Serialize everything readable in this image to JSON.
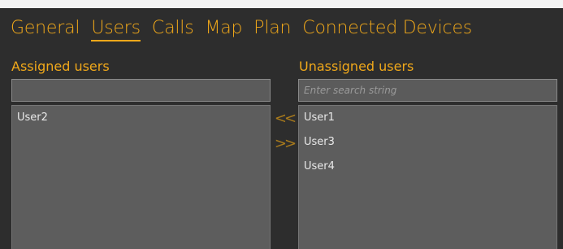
{
  "tabs": [
    {
      "label": "General",
      "active": false
    },
    {
      "label": "Users",
      "active": true
    },
    {
      "label": "Calls",
      "active": false
    },
    {
      "label": "Map",
      "active": false
    },
    {
      "label": "Plan",
      "active": false
    },
    {
      "label": "Connected Devices",
      "active": false
    }
  ],
  "assigned": {
    "title": "Assigned users",
    "filter_value": "",
    "items": [
      "User2"
    ]
  },
  "unassigned": {
    "title": "Unassigned users",
    "search_placeholder": "Enter search string",
    "items": [
      "User1",
      "User3",
      "User4"
    ]
  },
  "arrows": {
    "move_left": "<<",
    "move_right": ">>"
  },
  "colors": {
    "accent": "#f0a81a",
    "background": "#2d2d2d",
    "list_background": "#5d5d5d"
  }
}
